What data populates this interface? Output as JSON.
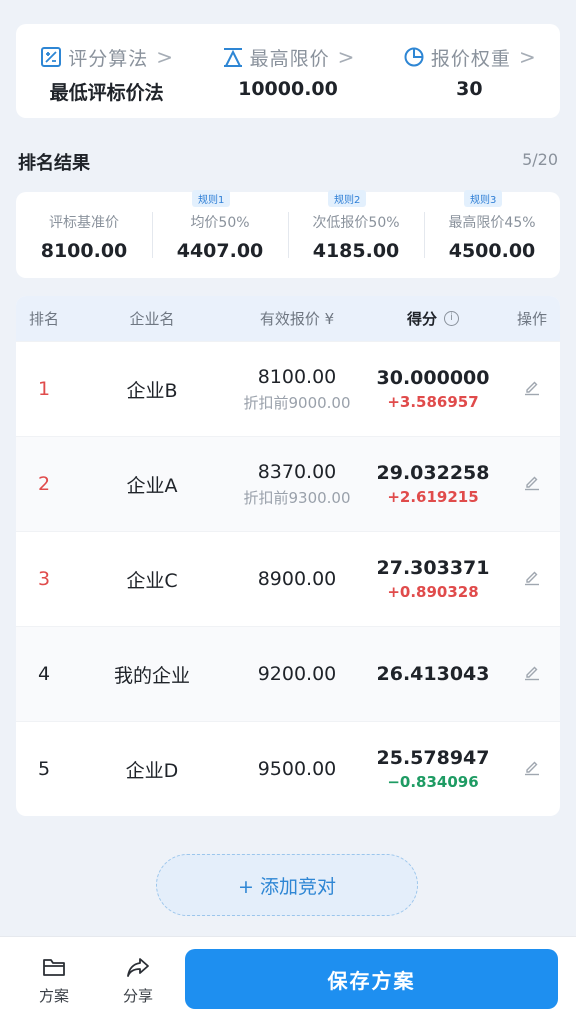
{
  "params": [
    {
      "label": "评分算法",
      "value": "最低评标价法",
      "icon": "formula-icon"
    },
    {
      "label": "最高限价",
      "value": "10000.00",
      "icon": "ceiling-price-icon"
    },
    {
      "label": "报价权重",
      "value": "30",
      "icon": "pie-chart-icon"
    }
  ],
  "params_chevron": ">",
  "ranking": {
    "title": "排名结果",
    "count": "5/20"
  },
  "stats": [
    {
      "label": "评标基准价",
      "value": "8100.00",
      "tag": ""
    },
    {
      "label": "均价50%",
      "value": "4407.00",
      "tag": "规则1"
    },
    {
      "label": "次低报价50%",
      "value": "4185.00",
      "tag": "规则2"
    },
    {
      "label": "最高限价45%",
      "value": "4500.00",
      "tag": "规则3"
    }
  ],
  "table": {
    "headers": {
      "rank": "排名",
      "company": "企业名",
      "price": "有效报价 ¥",
      "score": "得分",
      "score_info": "i",
      "action": "操作"
    },
    "rows": [
      {
        "rank": "1",
        "company": "企业B",
        "price": "8100.00",
        "original": "折扣前9000.00",
        "score": "30.000000",
        "diff": "+3.586957"
      },
      {
        "rank": "2",
        "company": "企业A",
        "price": "8370.00",
        "original": "折扣前9300.00",
        "score": "29.032258",
        "diff": "+2.619215"
      },
      {
        "rank": "3",
        "company": "企业C",
        "price": "8900.00",
        "original": "",
        "score": "27.303371",
        "diff": "+0.890328"
      },
      {
        "rank": "4",
        "company": "我的企业",
        "price": "9200.00",
        "original": "",
        "score": "26.413043",
        "diff": ""
      },
      {
        "rank": "5",
        "company": "企业D",
        "price": "9500.00",
        "original": "",
        "score": "25.578947",
        "diff": "−0.834096"
      }
    ]
  },
  "add_button": "+ 添加竞对",
  "bottom": {
    "plans_label": "方案",
    "share_label": "分享",
    "save_label": "保存方案"
  },
  "colors": {
    "accent": "#1e8ff0",
    "positive": "#e04b4b",
    "negative": "#1e9b63",
    "top_rank": "#e04b4b"
  }
}
